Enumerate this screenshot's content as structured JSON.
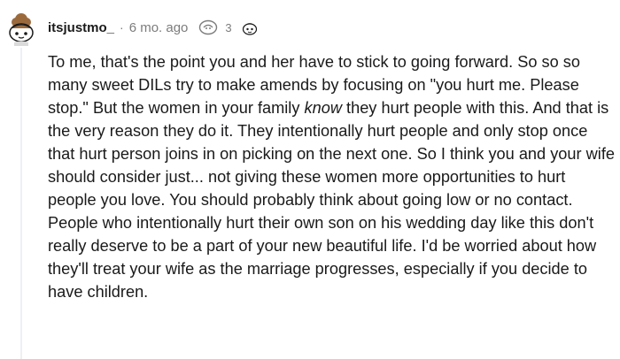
{
  "comment": {
    "username": "itsjustmo_",
    "separator": "·",
    "age": "6 mo. ago",
    "award_count": "3",
    "body_before_italic": "To me, that's the point you and her have to stick to going forward. So so so many sweet DILs try to make amends by focusing on \"you hurt me. Please stop.\" But the women in your family ",
    "body_italic": "know",
    "body_after_italic": " they hurt people with this. And that is the very reason they do it. They intentionally hurt people and only stop once that hurt person joins in on picking on the next one. So I think you and your wife should consider just... not giving these women more opportunities to hurt people you love. You should probably think about going low or no contact. People who intentionally hurt their own son on his wedding day like this don't really deserve to be a part of your new beautiful life. I'd be worried about how they'll treat your wife as the marriage progresses, especially if you decide to have children."
  },
  "icons": {
    "avatar": "reddit-avatar-icon",
    "award_1": "award-icon",
    "award_2": "award-icon"
  },
  "colors": {
    "text": "#1a1a1b",
    "meta": "#7c7c7c",
    "thread_line": "#edeff1"
  }
}
